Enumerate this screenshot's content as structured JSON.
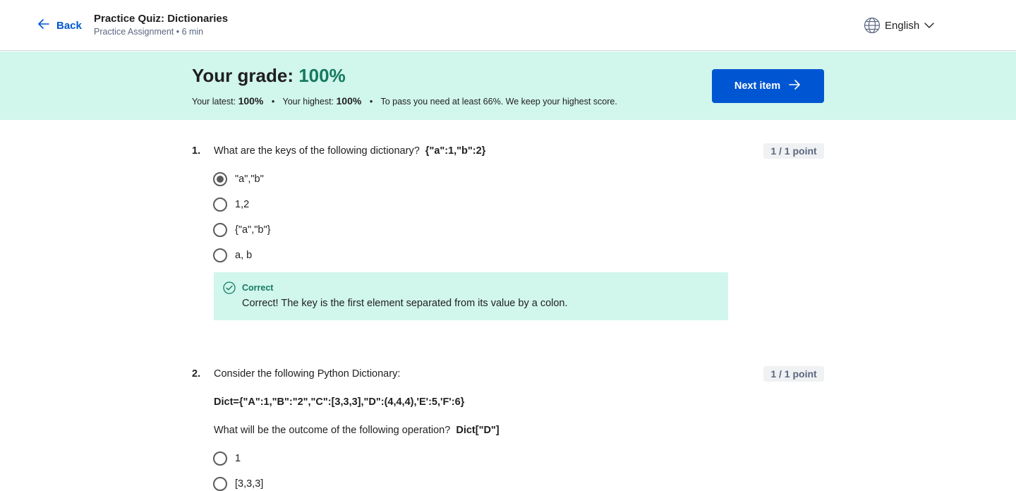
{
  "header": {
    "back_label": "Back",
    "title": "Practice Quiz: Dictionaries",
    "subtitle": "Practice Assignment • 6 min",
    "language": "English"
  },
  "banner": {
    "grade_label": "Your grade:",
    "grade_value": "100%",
    "latest_label": "Your latest:",
    "latest_value": "100%",
    "highest_label": "Your highest:",
    "highest_value": "100%",
    "pass_note": "To pass you need at least 66%. We keep your highest score.",
    "next_label": "Next item"
  },
  "questions": [
    {
      "number": "1.",
      "text": "What are the keys of the following dictionary?",
      "code": "{\"a\":1,\"b\":2}",
      "points": "1 / 1 point",
      "options": [
        "\"a\",\"b\"",
        "1,2",
        "{\"a\",\"b\"}",
        "a, b"
      ],
      "selected": 0,
      "feedback": {
        "title": "Correct",
        "text": "Correct! The key is the first element separated from its value by a colon."
      }
    },
    {
      "number": "2.",
      "text": "Consider the following Python Dictionary:",
      "code_block": "Dict={\"A\":1,\"B\":\"2\",\"C\":[3,3,3],\"D\":(4,4,4),'E':5,'F':6}",
      "prompt": "What will be the outcome of the following operation?",
      "prompt_code": "Dict[\"D\"]",
      "points": "1 / 1 point",
      "options": [
        "1",
        "[3,3,3]"
      ]
    }
  ],
  "colors": {
    "accent": "#0056d2",
    "success_bg": "#d1f6ec",
    "success_text": "#137a5f"
  }
}
